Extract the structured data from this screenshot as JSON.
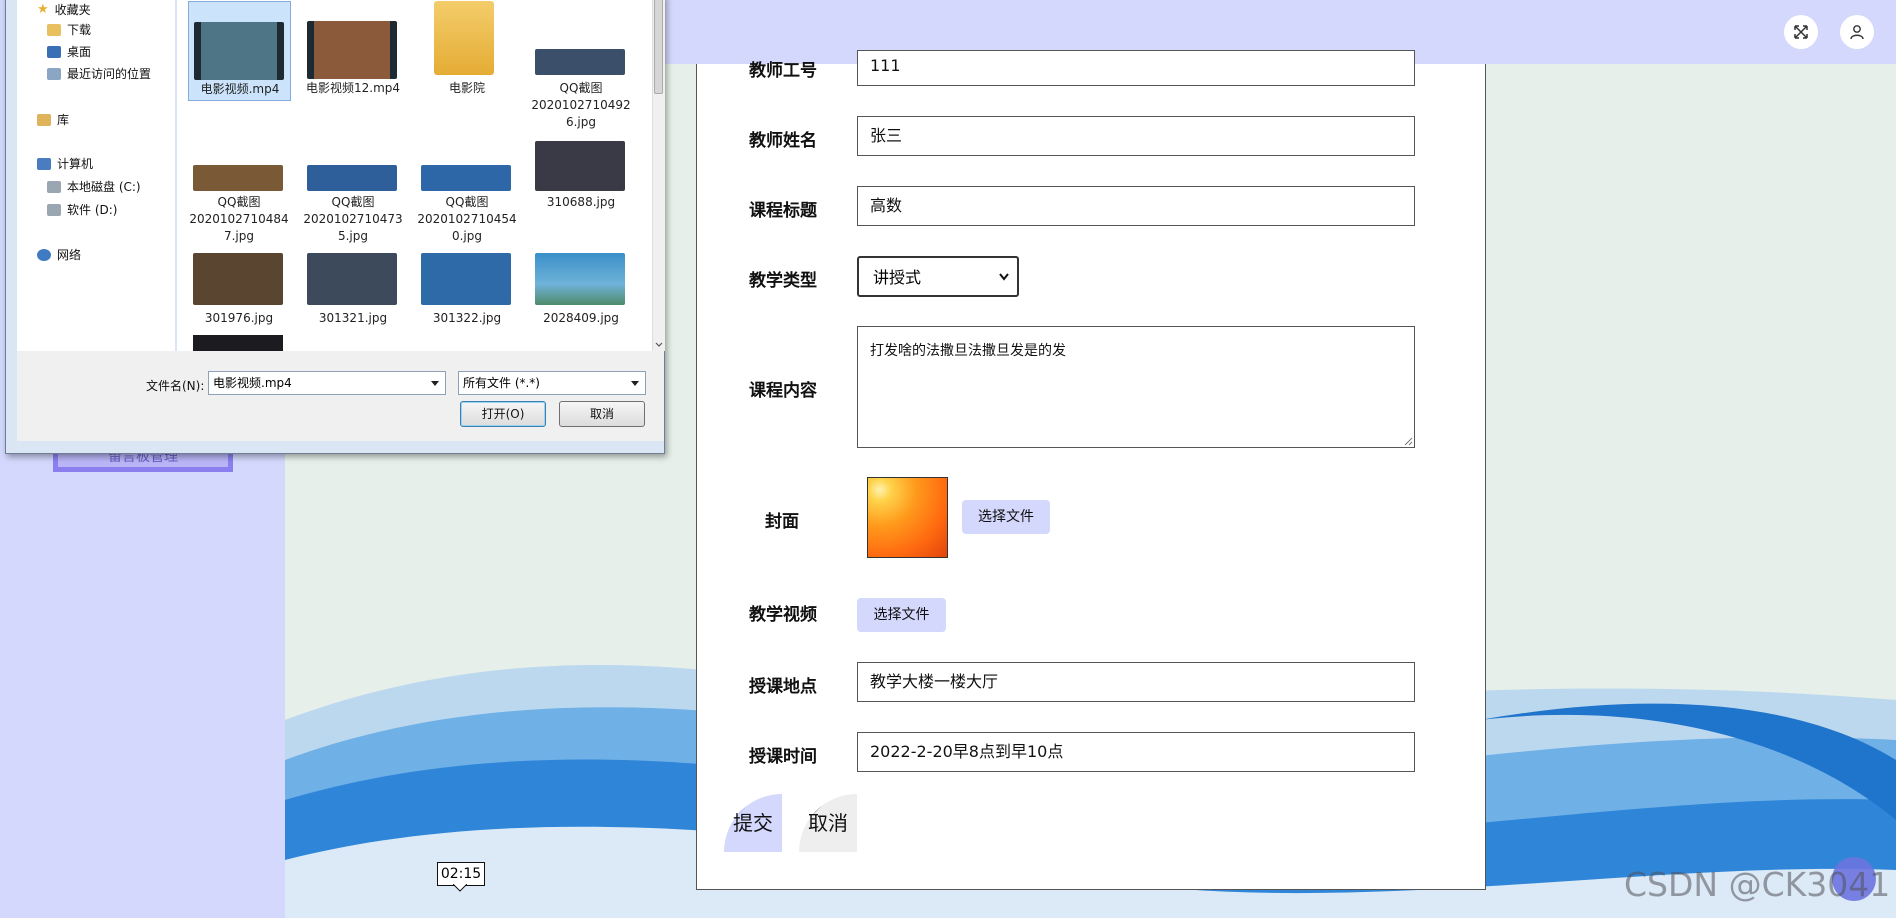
{
  "header": {
    "fullscreen_icon": "expand-arrows-icon",
    "user_icon": "user-icon"
  },
  "sidebar": {
    "partial_item_label": "留言板管理"
  },
  "form": {
    "teacher_id_label": "教师工号",
    "teacher_id_value": "111",
    "teacher_name_label": "教师姓名",
    "teacher_name_value": "张三",
    "course_title_label": "课程标题",
    "course_title_value": "高数",
    "teach_type_label": "教学类型",
    "teach_type_value": "讲授式",
    "course_content_label": "课程内容",
    "course_content_value": "打发啥的法撒旦法撒旦发是的发",
    "cover_label": "封面",
    "cover_button": "选择文件",
    "video_label": "教学视频",
    "video_button": "选择文件",
    "location_label": "授课地点",
    "location_value": "教学大楼一楼大厅",
    "schedule_label": "授课时间",
    "schedule_value": "2022-2-20早8点到早10点",
    "submit_label": "提交",
    "cancel_label": "取消"
  },
  "tooltip": {
    "time": "02:15"
  },
  "watermark": "CSDN @CK3041",
  "dialog": {
    "nav": {
      "favorites": "收藏夹",
      "downloads": "下载",
      "desktop": "桌面",
      "recent": "最近访问的位置",
      "library": "库",
      "computer": "计算机",
      "drive_c": "本地磁盘 (C:)",
      "drive_d": "软件 (D:)",
      "network": "网络"
    },
    "files": [
      {
        "name": "电影视频.mp4",
        "kind": "video"
      },
      {
        "name": "电影视频12.mp4",
        "kind": "video"
      },
      {
        "name": "电影院",
        "kind": "folder"
      },
      {
        "name": "QQ截图20201027104926.jpg",
        "line1": "QQ截图",
        "line2": "2020102710492",
        "line3": "6.jpg",
        "kind": "image"
      },
      {
        "name": "QQ截图20201027104847.jpg",
        "line1": "QQ截图",
        "line2": "2020102710484",
        "line3": "7.jpg",
        "kind": "image"
      },
      {
        "name": "QQ截图20201027104735.jpg",
        "line1": "QQ截图",
        "line2": "2020102710473",
        "line3": "5.jpg",
        "kind": "image"
      },
      {
        "name": "QQ截图20201027104540.jpg",
        "line1": "QQ截图",
        "line2": "2020102710454",
        "line3": "0.jpg",
        "kind": "image"
      },
      {
        "name": "310688.jpg",
        "kind": "image"
      },
      {
        "name": "301976.jpg",
        "kind": "image"
      },
      {
        "name": "301321.jpg",
        "kind": "image"
      },
      {
        "name": "301322.jpg",
        "kind": "image"
      },
      {
        "name": "2028409.jpg",
        "kind": "image"
      }
    ],
    "file_name_label": "文件名(N):",
    "file_name_value": "电影视频.mp4",
    "file_type_value": "所有文件 (*.*)",
    "open_button": "打开(O)",
    "cancel_button": "取消"
  },
  "colors": {
    "sidebar_bg": "#d3d8fc",
    "accent": "#8a92e8",
    "panel_bg": "#ffffff"
  }
}
